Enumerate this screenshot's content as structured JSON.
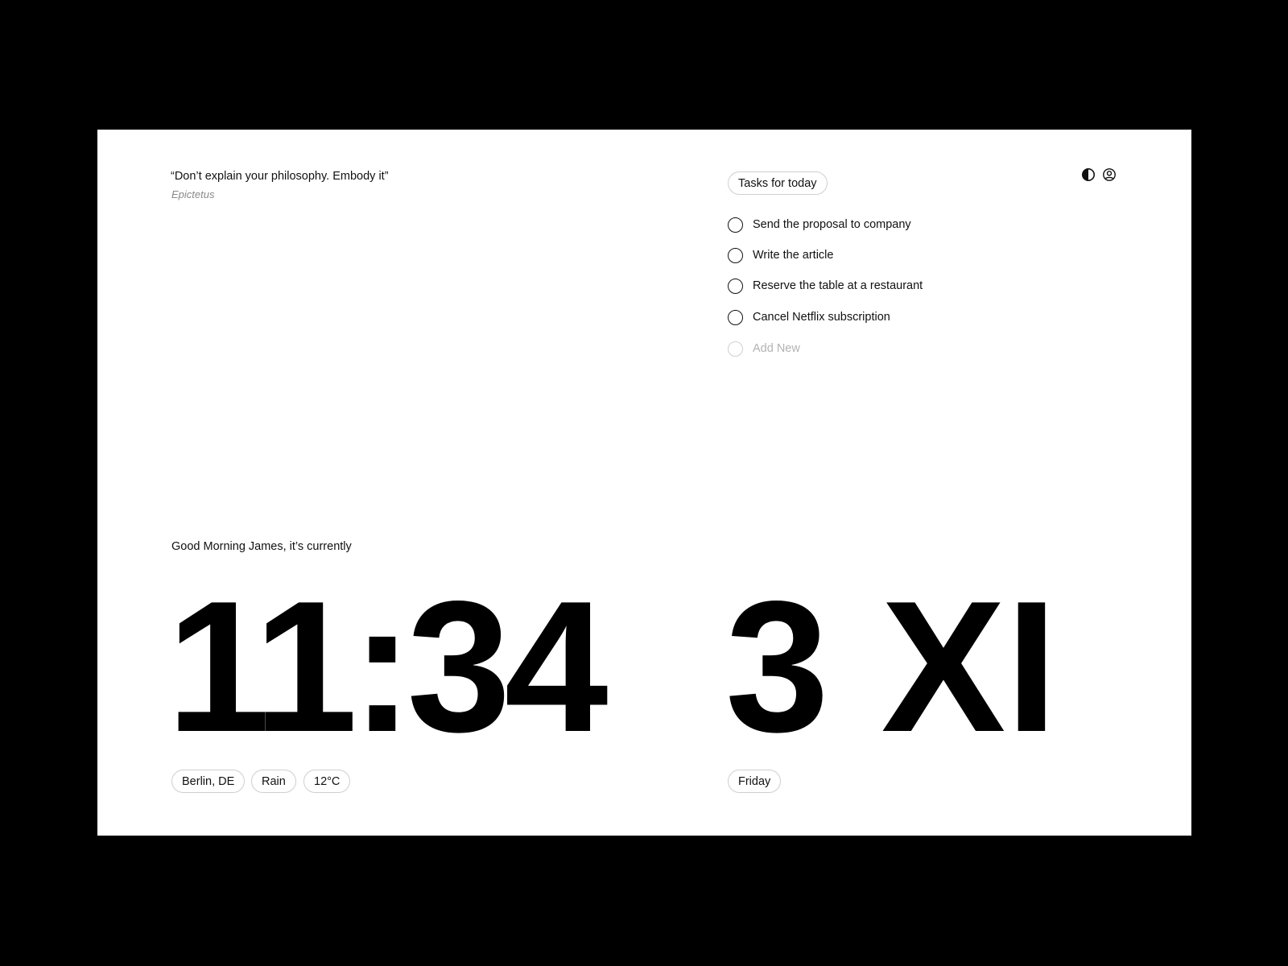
{
  "quote": {
    "text": "“Don’t explain your philosophy. Embody it”",
    "author": "Epictetus"
  },
  "tasks": {
    "title": "Tasks for today",
    "items": [
      {
        "label": "Send the proposal to company"
      },
      {
        "label": "Write the article"
      },
      {
        "label": "Reserve the table at a restaurant"
      },
      {
        "label": "Cancel Netflix subscription"
      }
    ],
    "add_label": "Add New"
  },
  "toolbar": {
    "theme_icon": "contrast-icon",
    "profile_icon": "user-icon"
  },
  "greeting": "Good Morning James, it’s currently",
  "clock": {
    "time": "11:34",
    "date": "3 XI"
  },
  "weather": {
    "location": "Berlin, DE",
    "condition": "Rain",
    "temperature": "12°C"
  },
  "day": "Friday",
  "colors": {
    "background": "#000000",
    "surface": "#ffffff",
    "text": "#111111",
    "muted": "#8a8a8a",
    "border": "#cfcfcf"
  }
}
